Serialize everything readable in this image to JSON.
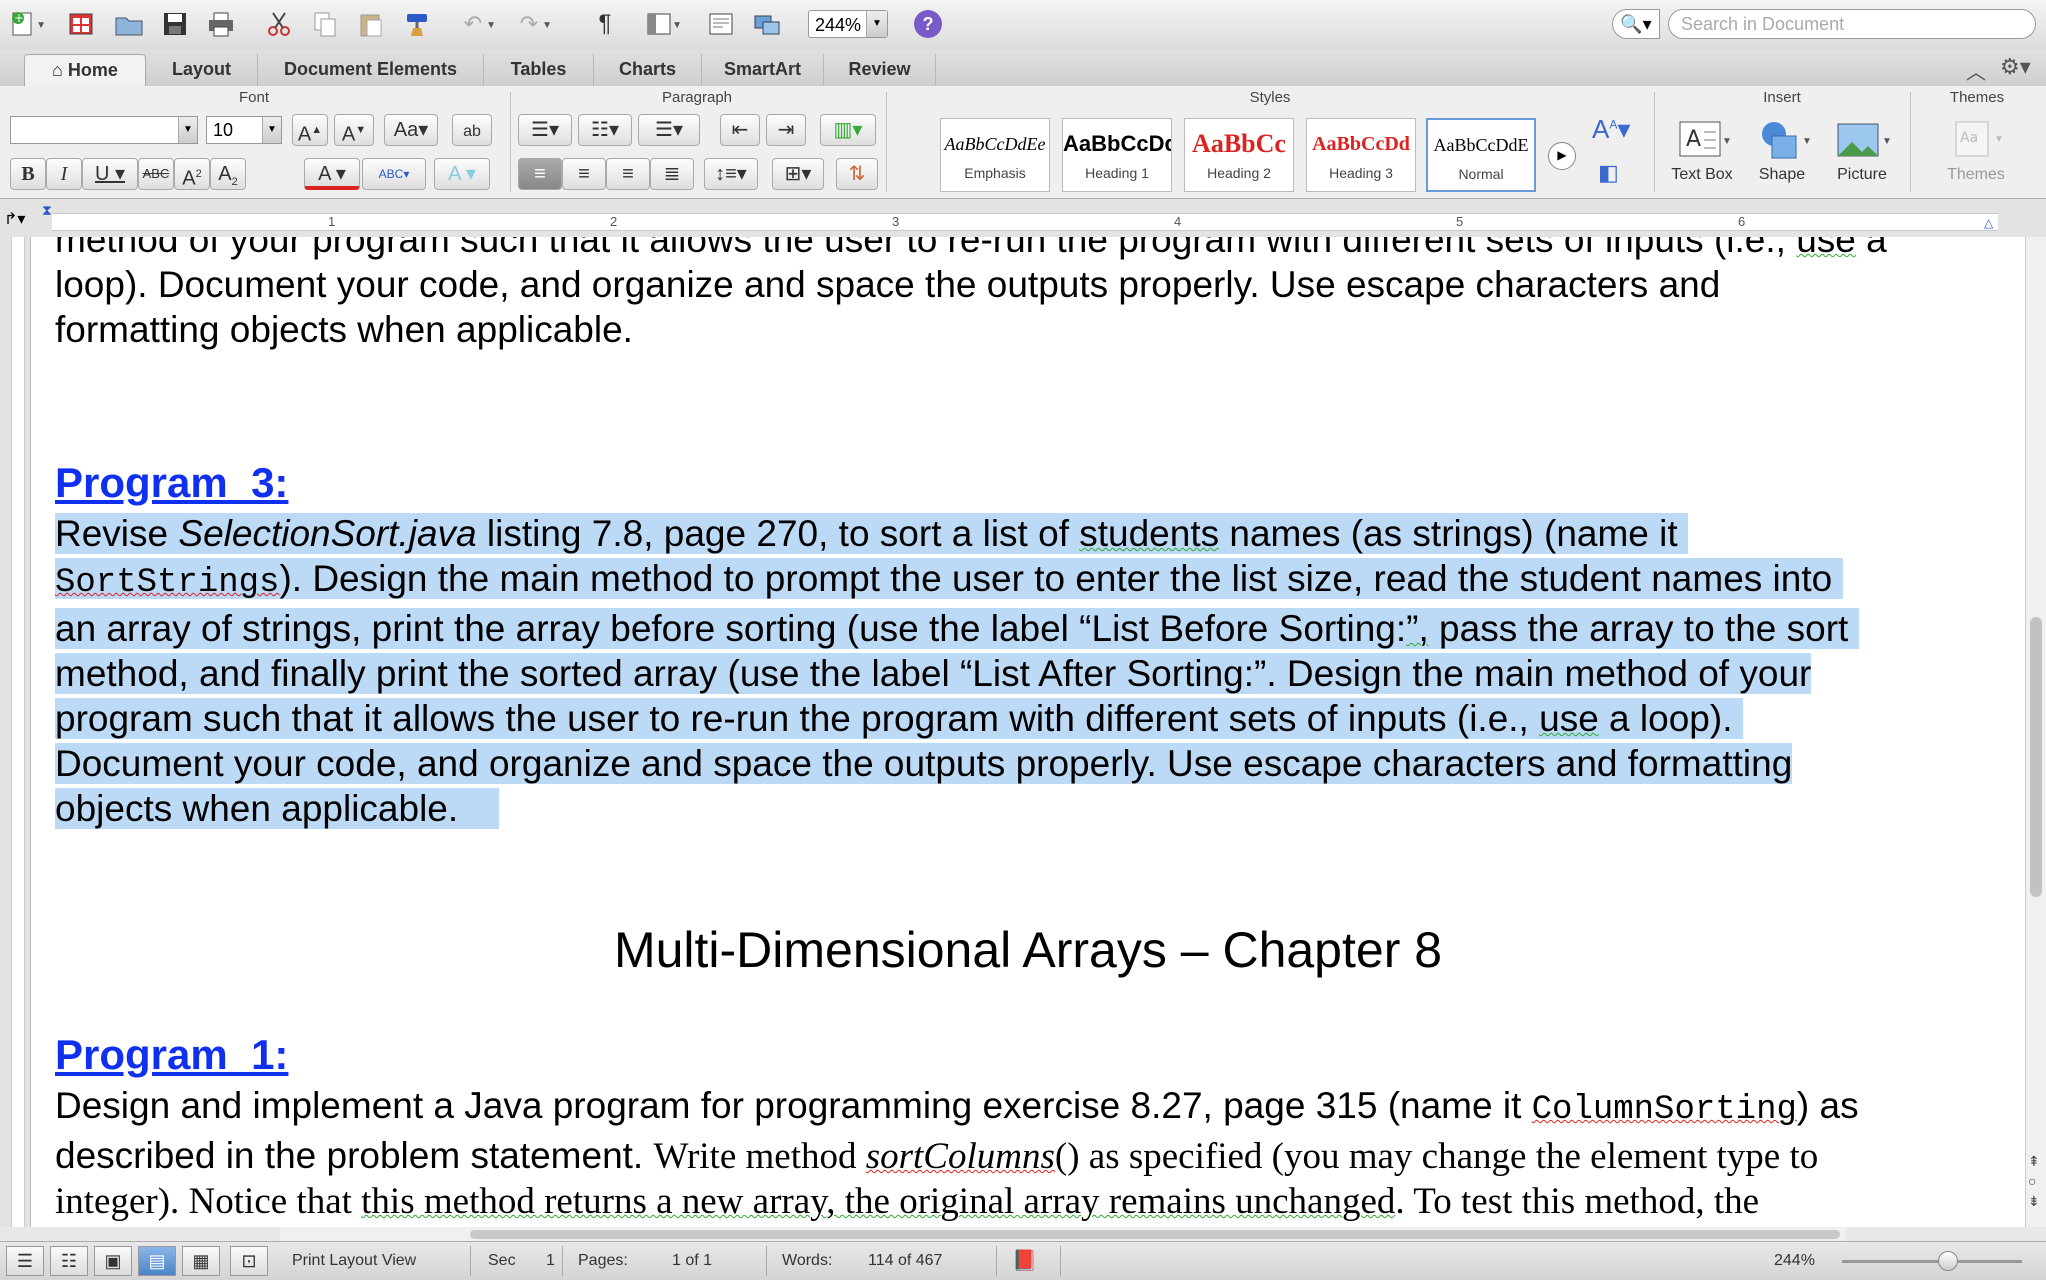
{
  "toolbar": {
    "zoom": "244%",
    "search_placeholder": "Search in Document"
  },
  "tabs": [
    "Home",
    "Layout",
    "Document Elements",
    "Tables",
    "Charts",
    "SmartArt",
    "Review"
  ],
  "ribbon": {
    "font_group": "Font",
    "paragraph_group": "Paragraph",
    "styles_group": "Styles",
    "insert_group": "Insert",
    "themes_group": "Themes",
    "font_name": "",
    "font_size": "10",
    "styles": [
      {
        "preview": "AaBbCcDdEe",
        "name": "Emphasis"
      },
      {
        "preview": "AaBbCcDd",
        "name": "Heading 1"
      },
      {
        "preview": "AaBbCc",
        "name": "Heading 2"
      },
      {
        "preview": "AaBbCcDd",
        "name": "Heading 3"
      },
      {
        "preview": "AaBbCcDdE",
        "name": "Normal"
      }
    ],
    "insert": [
      "Text Box",
      "Shape",
      "Picture"
    ],
    "themes_label": "Themes"
  },
  "ruler": [
    "1",
    "2",
    "3",
    "4",
    "5",
    "6"
  ],
  "document": {
    "para_top": {
      "line1a": "method of your program such that it allows the user to re-run the program with different sets of inputs (i.e., ",
      "line1_use": "use",
      "line1b": " a",
      "line2": "loop). Document your code, and organize and space the outputs properly. Use escape characters and",
      "line3": "formatting objects when applicable."
    },
    "program3_heading": "Program_3:",
    "program3": {
      "l1a": "Revise ",
      "l1_italic": "SelectionSort.java",
      "l1b": " listing 7.8, page 270, to sort a list of ",
      "l1_students": "students",
      "l1c": " names (as strings) (name it",
      "l2_code": "SortStrings",
      "l2b": "). Design the main method to prompt the user to enter the list size, read the student names into",
      "l3a": "an array of strings, print the array before sorting (use the label “List Before Sorting:",
      "l3_q": "”,",
      "l3b": " pass the array to the sort",
      "l4": "method, and finally print the sorted array (use the label “List After Sorting:”. Design the main method of your",
      "l5a": "program such that it allows the user to re-run the program with different sets of inputs (i.e., ",
      "l5_use": "use",
      "l5b": " a loop).",
      "l6": "Document your code, and organize and space the outputs properly. Use escape characters and formatting",
      "l7": "objects when applicable."
    },
    "chapter_title": "Multi-Dimensional Arrays – Chapter 8",
    "program1_heading": "Program_1:",
    "program1": {
      "l1a": "Design and implement a Java program for programming exercise 8.27, page 315 (name it ",
      "l1_code": "ColumnSorting",
      "l1b": ") as",
      "l2a": "described in the problem statement. ",
      "l2b": "Write method ",
      "l2_method": "sortColumns",
      "l2c": "() as specified (you may change the element type to",
      "l3a": "integer). Notice that ",
      "l3_wavy": "this method returns a new array, the original array remains unchanged",
      "l3b": ". To test this method, the"
    }
  },
  "status": {
    "view": "Print Layout View",
    "sec_label": "Sec",
    "sec_value": "1",
    "pages_label": "Pages:",
    "pages_value": "1 of 1",
    "words_label": "Words:",
    "words_value": "114 of 467",
    "zoom": "244%"
  }
}
